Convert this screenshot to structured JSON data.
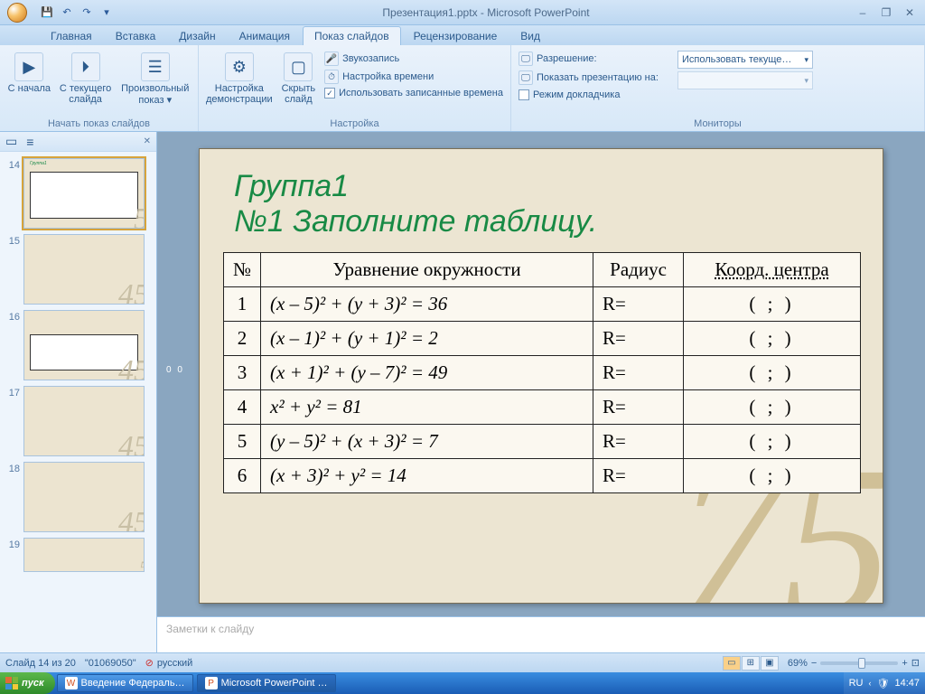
{
  "title": "Презентация1.pptx - Microsoft PowerPoint",
  "qat": {
    "save": "💾",
    "undo": "↶",
    "redo": "↷",
    "more": "▾"
  },
  "win": {
    "min": "–",
    "max": "❐",
    "close": "✕"
  },
  "tabs": [
    "Главная",
    "Вставка",
    "Дизайн",
    "Анимация",
    "Показ слайдов",
    "Рецензирование",
    "Вид"
  ],
  "active_tab_index": 4,
  "ribbon": {
    "g1": {
      "label": "Начать показ слайдов",
      "btn1": "С начала",
      "btn2": "С текущего слайда",
      "btn3": "Произвольный показ ▾"
    },
    "g2": {
      "label": "Настройка",
      "btn1": "Настройка демонстрации",
      "btn2": "Скрыть слайд",
      "row1": "Звукозапись",
      "row2": "Настройка времени",
      "row3": "Использовать записанные времена",
      "row3_checked": true
    },
    "g3": {
      "label": "Мониторы",
      "row1": "Разрешение:",
      "row2": "Показать презентацию на:",
      "row3": "Режим докладчика",
      "combo": "Использовать текуще…"
    }
  },
  "thumbs": [
    "14",
    "15",
    "16",
    "17",
    "18",
    "19"
  ],
  "selected_thumb": "14",
  "slide_count_label": "Слайд 14 из 20",
  "theme_label": "\"01069050\"",
  "lang_label": "русский",
  "notes_placeholder": "Заметки к слайду",
  "zoom_label": "69%",
  "slide": {
    "title_l1": "Группа1",
    "title_l2": "№1    Заполните таблицу.",
    "headers": {
      "n": "№",
      "eq": "Уравнение окружности",
      "r": "Радиус",
      "c": "Коорд. центра"
    },
    "rows": [
      {
        "n": "1",
        "eq": "(x – 5)² + (y + 3)² = 36",
        "r": "R=",
        "c": "(     ;     )"
      },
      {
        "n": "2",
        "eq": "(x – 1)² + (y + 1)² = 2",
        "r": "R=",
        "c": "(     ;     )"
      },
      {
        "n": "3",
        "eq": "(x + 1)² + (y – 7)² = 49",
        "r": "R=",
        "c": "(     ;     )"
      },
      {
        "n": "4",
        "eq": "x² +  y² = 81",
        "r": "R=",
        "c": "(     ;     )"
      },
      {
        "n": "5",
        "eq": "(y – 5)² + (x + 3)² = 7",
        "r": "R=",
        "c": "(     ;     )"
      },
      {
        "n": "6",
        "eq": "(x + 3)² + y² = 14",
        "r": "R=",
        "c": "(     ;     )"
      }
    ]
  },
  "taskbar": {
    "start": "пуск",
    "tasks": [
      "Введение Федераль…",
      "Microsoft PowerPoint …"
    ],
    "lang": "RU",
    "time": "14:47"
  }
}
